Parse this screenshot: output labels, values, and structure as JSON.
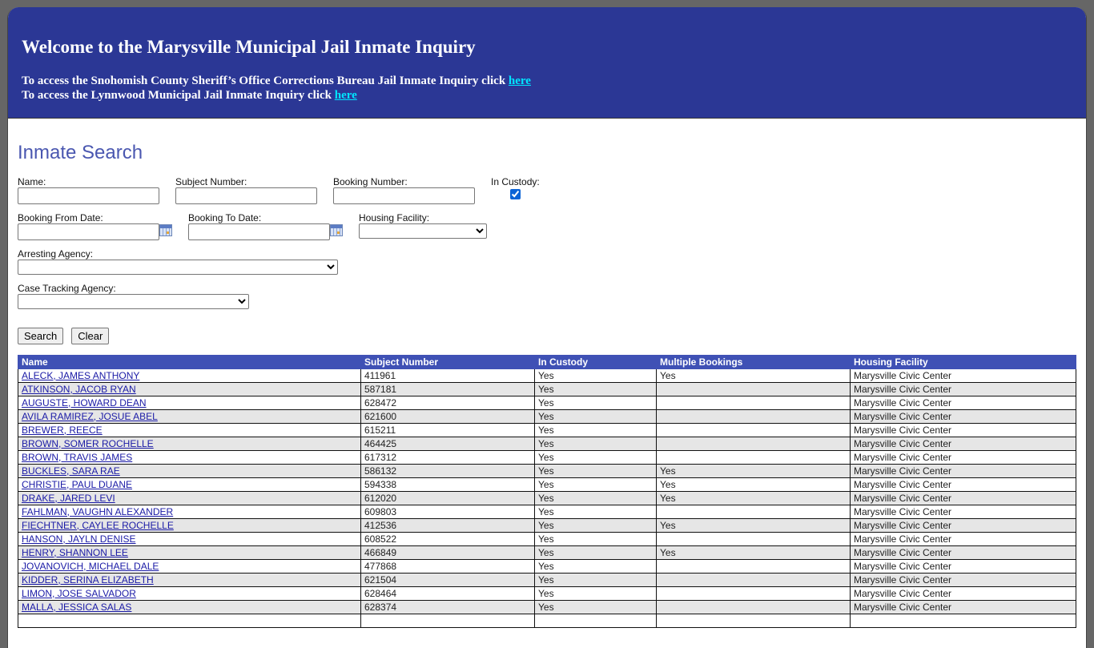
{
  "header": {
    "title": "Welcome to the Marysville Municipal Jail Inmate Inquiry",
    "link_lines": [
      {
        "text": "To access the Snohomish County Sheriff’s Office Corrections Bureau Jail Inmate Inquiry click ",
        "link": "here"
      },
      {
        "text": "To access the Lynnwood Municipal Jail Inmate Inquiry click ",
        "link": "here"
      }
    ]
  },
  "search": {
    "title": "Inmate Search",
    "fields": {
      "name": {
        "label": "Name:",
        "value": "",
        "placeholder": ""
      },
      "subject_number": {
        "label": "Subject Number:",
        "value": "",
        "placeholder": ""
      },
      "booking_number": {
        "label": "Booking Number:",
        "value": "",
        "placeholder": ""
      },
      "in_custody": {
        "label": "In Custody:",
        "checked": true
      },
      "booking_from_date": {
        "label": "Booking From Date:",
        "value": ""
      },
      "booking_to_date": {
        "label": "Booking To Date:",
        "value": ""
      },
      "housing_facility": {
        "label": "Housing Facility:",
        "selected": ""
      },
      "arresting_agency": {
        "label": "Arresting Agency:",
        "selected": ""
      },
      "case_tracking_agency": {
        "label": "Case Tracking Agency:",
        "selected": ""
      }
    },
    "buttons": {
      "search": "Search",
      "clear": "Clear"
    },
    "icons": {
      "date_picker": "calendar-icon"
    }
  },
  "results": {
    "columns": [
      "Name",
      "Subject Number",
      "In Custody",
      "Multiple Bookings",
      "Housing Facility"
    ],
    "rows": [
      {
        "name": "ALECK, JAMES ANTHONY",
        "subject_number": "411961",
        "in_custody": "Yes",
        "multiple_bookings": "Yes",
        "housing_facility": "Marysville Civic Center"
      },
      {
        "name": "ATKINSON, JACOB RYAN",
        "subject_number": "587181",
        "in_custody": "Yes",
        "multiple_bookings": "",
        "housing_facility": "Marysville Civic Center"
      },
      {
        "name": "AUGUSTE, HOWARD DEAN",
        "subject_number": "628472",
        "in_custody": "Yes",
        "multiple_bookings": "",
        "housing_facility": "Marysville Civic Center"
      },
      {
        "name": "AVILA RAMIREZ, JOSUE ABEL",
        "subject_number": "621600",
        "in_custody": "Yes",
        "multiple_bookings": "",
        "housing_facility": "Marysville Civic Center"
      },
      {
        "name": "BREWER, REECE",
        "subject_number": "615211",
        "in_custody": "Yes",
        "multiple_bookings": "",
        "housing_facility": "Marysville Civic Center"
      },
      {
        "name": "BROWN, SOMER ROCHELLE",
        "subject_number": "464425",
        "in_custody": "Yes",
        "multiple_bookings": "",
        "housing_facility": "Marysville Civic Center"
      },
      {
        "name": "BROWN, TRAVIS JAMES",
        "subject_number": "617312",
        "in_custody": "Yes",
        "multiple_bookings": "",
        "housing_facility": "Marysville Civic Center"
      },
      {
        "name": "BUCKLES, SARA RAE",
        "subject_number": "586132",
        "in_custody": "Yes",
        "multiple_bookings": "Yes",
        "housing_facility": "Marysville Civic Center"
      },
      {
        "name": "CHRISTIE, PAUL DUANE",
        "subject_number": "594338",
        "in_custody": "Yes",
        "multiple_bookings": "Yes",
        "housing_facility": "Marysville Civic Center"
      },
      {
        "name": "DRAKE, JARED LEVI",
        "subject_number": "612020",
        "in_custody": "Yes",
        "multiple_bookings": "Yes",
        "housing_facility": "Marysville Civic Center"
      },
      {
        "name": "FAHLMAN, VAUGHN ALEXANDER",
        "subject_number": "609803",
        "in_custody": "Yes",
        "multiple_bookings": "",
        "housing_facility": "Marysville Civic Center"
      },
      {
        "name": "FIECHTNER, CAYLEE ROCHELLE",
        "subject_number": "412536",
        "in_custody": "Yes",
        "multiple_bookings": "Yes",
        "housing_facility": "Marysville Civic Center"
      },
      {
        "name": "HANSON, JAYLN DENISE",
        "subject_number": "608522",
        "in_custody": "Yes",
        "multiple_bookings": "",
        "housing_facility": "Marysville Civic Center"
      },
      {
        "name": "HENRY, SHANNON LEE",
        "subject_number": "466849",
        "in_custody": "Yes",
        "multiple_bookings": "Yes",
        "housing_facility": "Marysville Civic Center"
      },
      {
        "name": "JOVANOVICH, MICHAEL DALE",
        "subject_number": "477868",
        "in_custody": "Yes",
        "multiple_bookings": "",
        "housing_facility": "Marysville Civic Center"
      },
      {
        "name": "KIDDER, SERINA ELIZABETH",
        "subject_number": "621504",
        "in_custody": "Yes",
        "multiple_bookings": "",
        "housing_facility": "Marysville Civic Center"
      },
      {
        "name": "LIMON, JOSE SALVADOR",
        "subject_number": "628464",
        "in_custody": "Yes",
        "multiple_bookings": "",
        "housing_facility": "Marysville Civic Center"
      },
      {
        "name": "MALLA, JESSICA SALAS",
        "subject_number": "628374",
        "in_custody": "Yes",
        "multiple_bookings": "",
        "housing_facility": "Marysville Civic Center"
      },
      {
        "name": "",
        "subject_number": "",
        "in_custody": "",
        "multiple_bookings": "",
        "housing_facility": ""
      }
    ]
  },
  "colors": {
    "header_bg": "#2b3795",
    "table_header_bg": "#3f51b5",
    "link": "#00e5ff",
    "title": "#4a57b0",
    "page_bg": "#666666"
  }
}
